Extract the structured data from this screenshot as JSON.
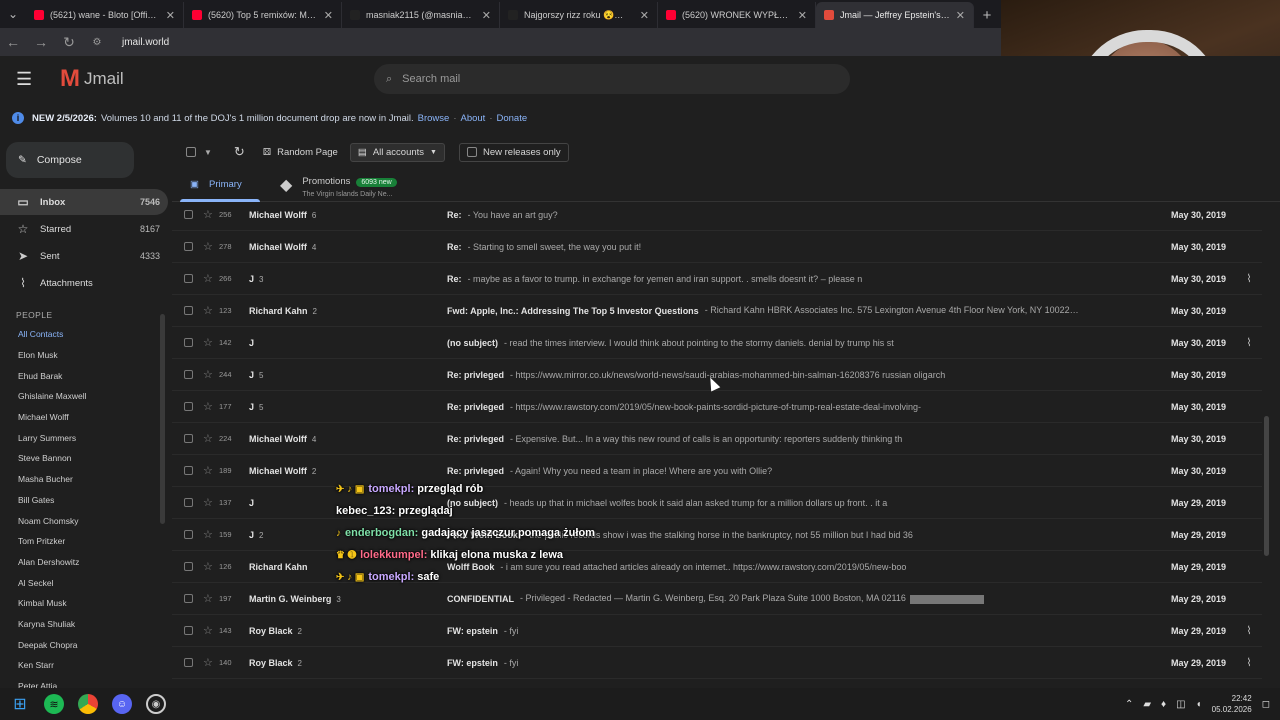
{
  "browser": {
    "tabs": [
      {
        "title": "(5621) wane - Bloto [Official M…",
        "color": "#ff0033",
        "active": false
      },
      {
        "title": "(5620) Top 5 remixów: Medusa",
        "color": "#ff0033",
        "active": false
      },
      {
        "title": "masniak2115 (@masniak2115)",
        "color": "#222222",
        "active": false
      },
      {
        "title": "Najgorszy rizz roku 😵😵😵 #",
        "color": "#222222",
        "active": false
      },
      {
        "title": "(5620) WRONEK WYPŁACA LIŚC",
        "color": "#ff0033",
        "active": false
      },
      {
        "title": "Jmail — Jeffrey Epstein's Emails",
        "color": "#e24b3c",
        "active": true
      }
    ],
    "url": "jmail.world"
  },
  "app": {
    "logo_mark": "M",
    "logo_text": "Jmail",
    "search_placeholder": "Search mail",
    "banner": {
      "bold": "NEW 2/5/2026:",
      "text": "Volumes 10 and 11 of the DOJ's 1 million document drop are now in Jmail.",
      "links": [
        "Browse",
        "About",
        "Donate"
      ],
      "sep": "·"
    }
  },
  "sidebar": {
    "compose": "Compose",
    "items": [
      {
        "label": "Inbox",
        "count": "7546",
        "icon": "inbox-icon",
        "glyph": "▭",
        "active": true
      },
      {
        "label": "Starred",
        "count": "8167",
        "icon": "star-icon",
        "glyph": "☆",
        "active": false
      },
      {
        "label": "Sent",
        "count": "4333",
        "icon": "send-icon",
        "glyph": "➤",
        "active": false
      },
      {
        "label": "Attachments",
        "count": "",
        "icon": "paperclip-icon",
        "glyph": "⌇",
        "active": false
      }
    ],
    "people_heading": "PEOPLE",
    "contacts": [
      "All Contacts",
      "Elon Musk",
      "Ehud Barak",
      "Ghislaine Maxwell",
      "Michael Wolff",
      "Larry Summers",
      "Steve Bannon",
      "Masha Bucher",
      "Bill Gates",
      "Noam Chomsky",
      "Tom Pritzker",
      "Alan Dershowitz",
      "Al Seckel",
      "Kimbal Musk",
      "Karyna Shuliak",
      "Deepak Chopra",
      "Ken Starr",
      "Peter Attia"
    ]
  },
  "toolbar": {
    "random_page": "Random Page",
    "all_accounts": "All accounts",
    "new_releases": "New releases only"
  },
  "tabs": {
    "primary": "Primary",
    "promotions": "Promotions",
    "promotions_badge": "6093 new",
    "promotions_sub": "The Virgin Islands Daily Ne..."
  },
  "emails": [
    {
      "num": "256",
      "sender": "Michael Wolff",
      "count": "6",
      "subject": "Re:",
      "snippet": "- You have an art guy?",
      "date": "May 30, 2019",
      "attach": false,
      "redact": false
    },
    {
      "num": "278",
      "sender": "Michael Wolff",
      "count": "4",
      "subject": "Re:",
      "snippet": "- Starting to smell sweet, the way you put it!",
      "date": "May 30, 2019",
      "attach": false,
      "redact": false
    },
    {
      "num": "266",
      "sender": "J",
      "count": "3",
      "subject": "Re:",
      "snippet": "- maybe as a favor to trump. in exchange for yemen and iran support. . smells doesnt it? – please n",
      "date": "May 30, 2019",
      "attach": true,
      "redact": false
    },
    {
      "num": "123",
      "sender": "Richard Kahn",
      "count": "2",
      "subject": "Fwd: Apple, Inc.: Addressing The Top 5 Investor Questions",
      "snippet": "- Richard Kahn HBRK Associates Inc. 575 Lexington Avenue 4th Floor New York, NY 10022",
      "date": "May 30, 2019",
      "attach": false,
      "redact": true,
      "after": "B"
    },
    {
      "num": "142",
      "sender": "J",
      "count": "",
      "subject": "(no subject)",
      "snippet": "- read the times interview. I would think about pointing to the stormy daniels. denial by trump his st",
      "date": "May 30, 2019",
      "attach": true,
      "redact": false
    },
    {
      "num": "244",
      "sender": "J",
      "count": "5",
      "subject": "Re: privleged",
      "snippet": "- https://www.mirror.co.uk/news/world-news/saudi-arabias-mohammed-bin-salman-16208376 russian oligarch",
      "date": "May 30, 2019",
      "attach": false,
      "redact": false
    },
    {
      "num": "177",
      "sender": "J",
      "count": "5",
      "subject": "Re: privleged",
      "snippet": "- https://www.rawstory.com/2019/05/new-book-paints-sordid-picture-of-trump-real-estate-deal-involving-",
      "date": "May 30, 2019",
      "attach": false,
      "redact": false
    },
    {
      "num": "224",
      "sender": "Michael Wolff",
      "count": "4",
      "subject": "Re: privleged",
      "snippet": "- Expensive. But... In a way this new round of calls is an opportunity: reporters suddenly thinking th",
      "date": "May 30, 2019",
      "attach": false,
      "redact": false
    },
    {
      "num": "189",
      "sender": "Michael Wolff",
      "count": "2",
      "subject": "Re: privleged",
      "snippet": "- Again! Why you need a team in place! Where are you with Ollie?",
      "date": "May 30, 2019",
      "attach": false,
      "redact": false
    },
    {
      "num": "137",
      "sender": "J",
      "count": "",
      "subject": "(no subject)",
      "snippet": "- heads up that in michael wolfes book it said alan asked trump for a million dollars up front. . it a",
      "date": "May 29, 2019",
      "attach": false,
      "redact": false
    },
    {
      "num": "159",
      "sender": "J",
      "count": "2",
      "subject": "Fwd: Wolff Book",
      "snippet": "- the public records show i was the stalking horse in the bankruptcy, not 55 million but I had bid 36",
      "date": "May 29, 2019",
      "attach": false,
      "redact": false
    },
    {
      "num": "126",
      "sender": "Richard Kahn",
      "count": "",
      "subject": "Wolff Book",
      "snippet": "- i am sure you read attached articles already on internet.. https://www.rawstory.com/2019/05/new-boo",
      "date": "May 29, 2019",
      "attach": false,
      "redact": false
    },
    {
      "num": "197",
      "sender": "Martin G. Weinberg",
      "count": "3",
      "subject": "CONFIDENTIAL",
      "snippet": "- Privileged - Redacted — Martin G. Weinberg, Esq. 20 Park Plaza Suite 1000 Boston, MA 02116",
      "date": "May 29, 2019",
      "attach": false,
      "redact": true,
      "after": ""
    },
    {
      "num": "143",
      "sender": "Roy Black",
      "count": "2",
      "subject": "FW: epstein",
      "snippet": "- fyi",
      "date": "May 29, 2019",
      "attach": true,
      "redact": false
    },
    {
      "num": "140",
      "sender": "Roy Black",
      "count": "2",
      "subject": "FW: epstein",
      "snippet": "- fyi",
      "date": "May 29, 2019",
      "attach": true,
      "redact": false
    }
  ],
  "chat": [
    {
      "emotes": "✈ ♪ ▣",
      "user": "tomekpl:",
      "color": "#c8a8ff",
      "msg": "przegląd rób"
    },
    {
      "emotes": "",
      "user": "kebec_123:",
      "color": "#ffffff",
      "msg": "przeglądaj"
    },
    {
      "emotes": "♪",
      "user": "enderbogdan:",
      "color": "#7fe0a8",
      "msg": "gadający jaszczur pomaga żułom"
    },
    {
      "emotes": "♛ ➊",
      "user": "lolekkumpel:",
      "color": "#ff6b8a",
      "msg": "klikaj elona muska z lewa"
    },
    {
      "emotes": "✈ ♪ ▣",
      "user": "tomekpl:",
      "color": "#c8a8ff",
      "msg": "safe"
    }
  ],
  "taskbar": {
    "time": "22:42",
    "date": "05.02.2026"
  }
}
